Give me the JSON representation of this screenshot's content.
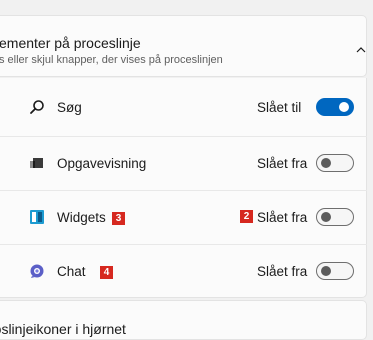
{
  "section": {
    "title": "ementer på proceslinje",
    "subtitle": "s eller skjul knapper, der vises på proceslinjen"
  },
  "items": [
    {
      "label": "Søg",
      "state": "Slået til",
      "on": true,
      "icon": "search-icon"
    },
    {
      "label": "Opgavevisning",
      "state": "Slået fra",
      "on": false,
      "icon": "task-view-icon"
    },
    {
      "label": "Widgets",
      "state": "Slået fra",
      "on": false,
      "icon": "widgets-icon"
    },
    {
      "label": "Chat",
      "state": "Slået fra",
      "on": false,
      "icon": "chat-icon"
    }
  ],
  "badges": {
    "widgets_label": "3",
    "widgets_state": "2",
    "chat_label": "4"
  },
  "next_section": {
    "title": "roslinjeikoner i hjørnet"
  },
  "colors": {
    "accent": "#0067c0",
    "badge": "#d6281f"
  }
}
